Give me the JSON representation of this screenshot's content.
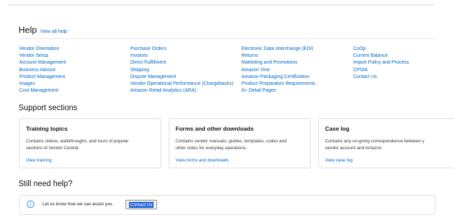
{
  "help": {
    "title": "Help",
    "view_all": "View all help",
    "columns": [
      [
        "Vendor Orientation",
        "Vendor Setup",
        "Account Management",
        "Business Advisor",
        "Product Management",
        "Images",
        "Cost Management"
      ],
      [
        "Purchase Orders",
        "Invoices",
        "Direct Fulfillment",
        "Shipping",
        "Dispute Management",
        "Vendor Operational Performance (Chargebacks)",
        "Amazon Retail Analytics (ARA)"
      ],
      [
        "Electronic Data Interchange (EDI)",
        "Returns",
        "Marketing and Promotions",
        "Amazon Vine",
        "Amazon Packaging Certification",
        "Product Preparation Requirements",
        "A+ Detail Pages"
      ],
      [
        "CoOp",
        "Current Balance",
        "Import Policy and Process",
        "CPSIA",
        "Contact Us"
      ]
    ]
  },
  "support": {
    "title": "Support sections",
    "cards": [
      {
        "title": "Training topics",
        "desc": [
          "Contains videos, walkthroughs, and tours of popular",
          "sections of Vendor Central."
        ],
        "link": "View training"
      },
      {
        "title": "Forms and other downloads",
        "desc": [
          "Contains vendor manuals, guides, templates, codes and",
          "other notes for everyday operations."
        ],
        "link": "View forms and downloads"
      },
      {
        "title": "Case log",
        "desc": [
          "Contains any on-going correspondence between y",
          "vendor account and Amazon."
        ],
        "link": "View case log"
      }
    ]
  },
  "still_need_help": {
    "title": "Still need help?",
    "message": "Let us know how we can assist you.",
    "button": "Contact Us",
    "icon": "info-icon"
  },
  "colors": {
    "link": "#0066c0",
    "border": "#dddddd",
    "info": "#3a8ee6",
    "selection": "#2d6ad8"
  }
}
